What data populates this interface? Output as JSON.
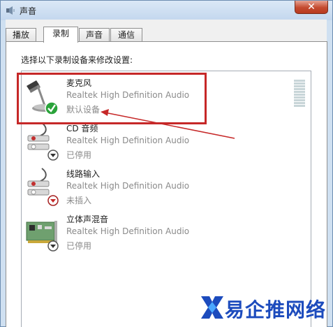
{
  "window": {
    "title": "声音",
    "close_glyph": "✕"
  },
  "tabs": [
    {
      "label": "播放",
      "active": false
    },
    {
      "label": "录制",
      "active": true
    },
    {
      "label": "声音",
      "active": false
    },
    {
      "label": "通信",
      "active": false
    }
  ],
  "instruction": "选择以下录制设备来修改设置:",
  "devices": [
    {
      "name": "麦克风",
      "driver": "Realtek High Definition Audio",
      "status": "默认设备",
      "icon": "microphone-icon",
      "badge": "default-check-icon"
    },
    {
      "name": "CD 音频",
      "driver": "Realtek High Definition Audio",
      "status": "已停用",
      "icon": "audio-jack-icon",
      "badge": "disabled-arrow-icon"
    },
    {
      "name": "线路输入",
      "driver": "Realtek High Definition Audio",
      "status": "未插入",
      "icon": "audio-jack-icon",
      "badge": "unplugged-arrow-icon"
    },
    {
      "name": "立体声混音",
      "driver": "Realtek High Definition Audio",
      "status": "已停用",
      "icon": "sound-card-icon",
      "badge": "disabled-arrow-icon"
    }
  ],
  "watermark": {
    "text": "易企推网络"
  },
  "colors": {
    "highlight": "#c62828",
    "accent_check": "#2aa33a",
    "watermark": "#1c4bbd",
    "title_bar": "#c3d7ee"
  }
}
